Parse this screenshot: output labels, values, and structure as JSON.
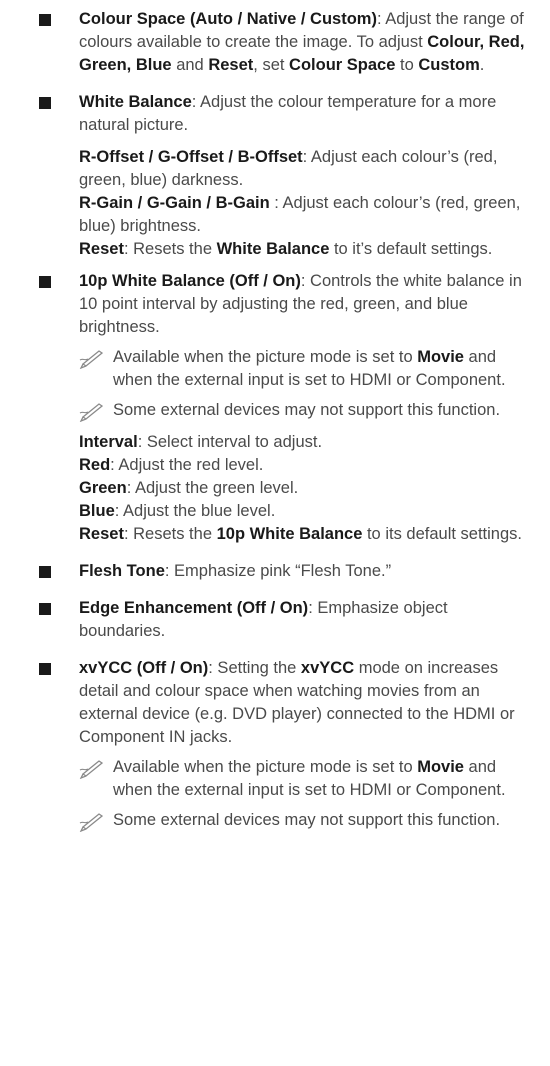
{
  "items": {
    "colour_space": {
      "title": "Colour Space (Auto / Native / Custom)",
      "desc1": ": Adjust the range of colours available to create the image. To adjust ",
      "b_targets": "Colour, Red, Green, Blue",
      "and": " and ",
      "b_reset": "Reset",
      "set": ", set ",
      "b_cs": "Colour Space",
      "to": " to ",
      "b_custom": "Custom",
      "end": "."
    },
    "white_balance": {
      "title": "White Balance",
      "desc": ": Adjust the colour temperature for a more natural picture.",
      "offset_label": "R-Offset / G-Offset / B-Offset",
      "offset_desc": ": Adjust each colour’s (red, green, blue) darkness.",
      "gain_label": "R-Gain / G-Gain / B-Gain",
      "gain_desc": " : Adjust each colour’s (red, green, blue) brightness.",
      "reset_label": "Reset",
      "reset_desc1": ": Resets the ",
      "reset_bold": "White Balance",
      "reset_desc2": " to it’s default settings."
    },
    "ten_p": {
      "title": "10p White Balance (Off / On)",
      "desc": ": Controls the white balance in 10 point interval by adjusting the red, green, and blue brightness.",
      "note1_a": "Available when the picture mode is set to ",
      "note1_bold": "Movie",
      "note1_b": " and when the external input is set to HDMI or Component.",
      "note2": "Some external devices may not support this function.",
      "interval_label": "Interval",
      "interval_desc": ": Select interval to adjust.",
      "red_label": "Red",
      "red_desc": ": Adjust the red level.",
      "green_label": "Green",
      "green_desc": ": Adjust the green level.",
      "blue_label": "Blue",
      "blue_desc": ": Adjust the blue level.",
      "reset_label": "Reset",
      "reset_desc1": ": Resets the ",
      "reset_bold": "10p White Balance",
      "reset_desc2": " to its default settings."
    },
    "flesh_tone": {
      "title": "Flesh Tone",
      "desc": ": Emphasize pink “Flesh Tone.”"
    },
    "edge": {
      "title": "Edge Enhancement (Off / On)",
      "desc": ": Emphasize object boundaries."
    },
    "xvycc": {
      "title": "xvYCC (Off / On)",
      "desc1": ": Setting the ",
      "bold": "xvYCC",
      "desc2": " mode on increases detail and colour space when watching movies from an external device (e.g. DVD player) connected to the HDMI or Component IN jacks.",
      "note1_a": "Available when the picture mode is set to ",
      "note1_bold": "Movie",
      "note1_b": " and when the external input is set to HDMI or Component.",
      "note2": "Some external devices may not support this function."
    }
  },
  "icons": {
    "bullet": "black-square-bullet",
    "note": "pencil-note-icon"
  }
}
